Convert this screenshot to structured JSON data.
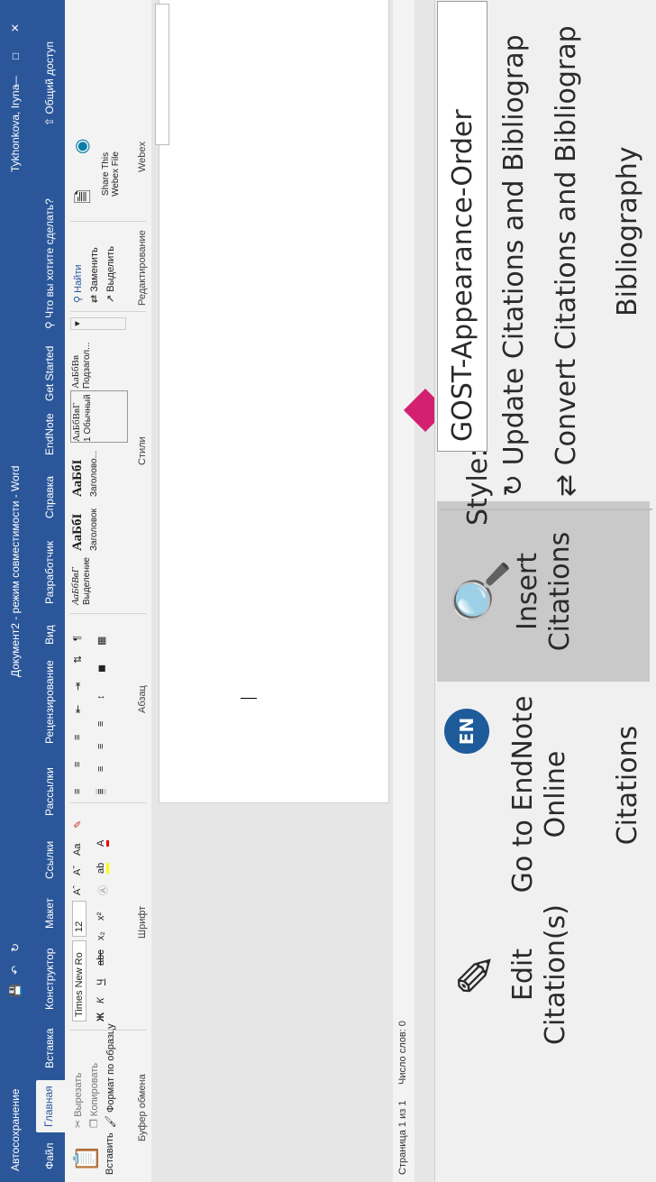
{
  "word": {
    "title": "Документ2 - режим совместимости - Word",
    "autosave": "Автосохранение",
    "user": "Tykhonkova, Iryna",
    "tabs": [
      "Файл",
      "Главная",
      "Вставка",
      "Конструктор",
      "Макет",
      "Ссылки",
      "Рассылки",
      "Рецензирование",
      "Вид",
      "Разработчик",
      "Справка",
      "EndNote",
      "Get Started"
    ],
    "tell_me": "Что вы хотите сделать?",
    "share": "Общий доступ",
    "clipboard": {
      "paste": "Вставить",
      "cut": "Вырезать",
      "copy": "Копировать",
      "format": "Формат по образцу",
      "label": "Буфер обмена"
    },
    "font": {
      "name": "Times New Ro",
      "size": "12",
      "label": "Шрифт"
    },
    "paragraph": {
      "label": "Абзац"
    },
    "styles": {
      "items": [
        "Выделение",
        "Заголовок",
        "Заголово...",
        "1 Обычный",
        "Подзагол..."
      ],
      "label": "Стили"
    },
    "editing": {
      "find": "Найти",
      "replace": "Заменить",
      "select": "Выделить",
      "label": "Редактирование"
    },
    "webex": {
      "share_file": "Share This Webex File",
      "label": "Webex"
    },
    "status": {
      "page": "Страница 1 из 1",
      "words": "Число слов: 0"
    }
  },
  "endnote": {
    "insert": "Insert Citations",
    "goto": "Go to EndNote Online",
    "edit": "Edit Citation(s)",
    "citations_group": "Citations",
    "style_label": "Style:",
    "style_value": "GOST-Appearance-Order",
    "update": "Update Citations and Bibliograp",
    "convert": "Convert Citations and Bibliograp",
    "bibliography_group": "Bibliography"
  }
}
